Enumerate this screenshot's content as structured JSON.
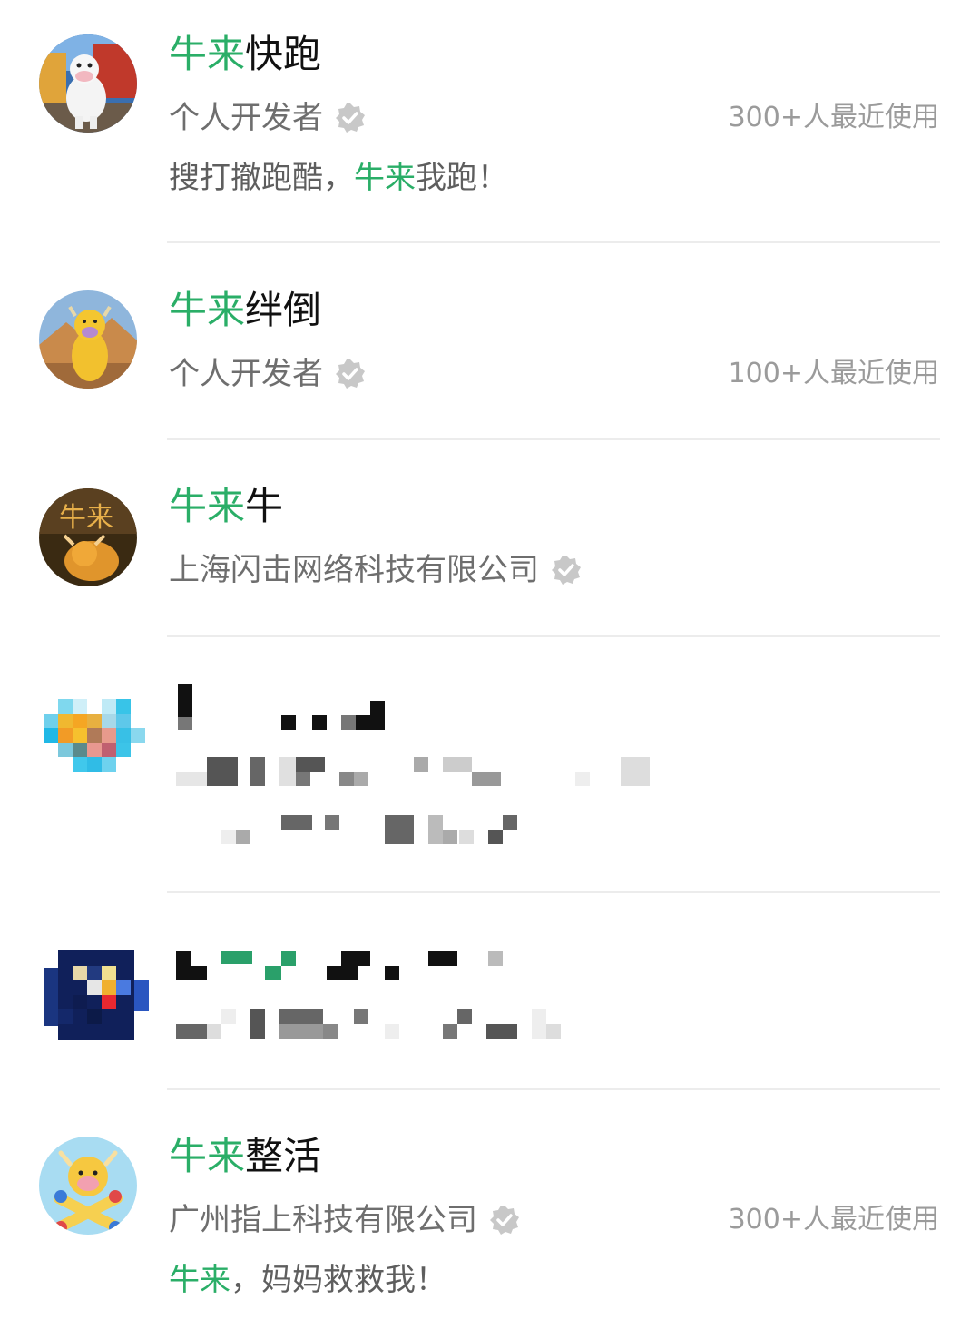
{
  "colors": {
    "highlight": "#2aae67",
    "title": "#111111",
    "subtitle": "#6e6e6e",
    "usage": "#9b9b9b",
    "divider": "#ececec",
    "verified_badge": "#c8c8c8"
  },
  "results": [
    {
      "title_highlight": "牛来",
      "title_rest": "快跑",
      "developer": "个人开发者",
      "verified": true,
      "usage": "300+人最近使用",
      "desc_parts": [
        "搜打撤跑酷，",
        "牛来",
        "我跑！"
      ],
      "avatar_icon": "cow-runner-avatar-icon"
    },
    {
      "title_highlight": "牛来",
      "title_rest": "绊倒",
      "developer": "个人开发者",
      "verified": true,
      "usage": "100+人最近使用",
      "avatar_icon": "yellow-ox-avatar-icon"
    },
    {
      "title_highlight": "牛来",
      "title_rest": "牛",
      "developer": "上海闪击网络科技有限公司",
      "verified": true,
      "usage": "",
      "avatar_icon": "golden-ox-avatar-icon"
    },
    {
      "blurred": true,
      "avatar_icon": "pixelated-avatar-icon"
    },
    {
      "blurred": true,
      "avatar_icon": "pixelated-blue-avatar-icon"
    },
    {
      "title_highlight": "牛来",
      "title_rest": "整活",
      "developer": "广州指上科技有限公司",
      "verified": true,
      "usage": "300+人最近使用",
      "desc_parts": [
        "",
        "牛来",
        "，妈妈救救我！"
      ],
      "avatar_icon": "cartoon-ox-avatar-icon"
    }
  ]
}
